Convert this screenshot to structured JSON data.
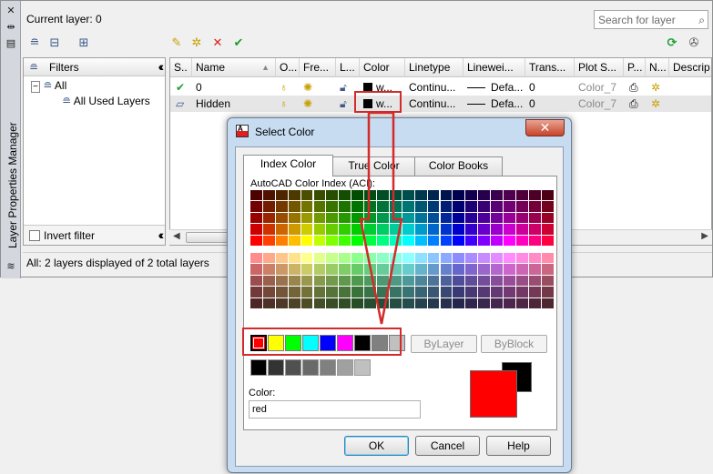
{
  "palette": {
    "title": "Layer Properties Manager",
    "current_layer": "Current layer: 0",
    "search_placeholder": "Search for layer",
    "filters": {
      "header": "Filters",
      "tree": [
        "All",
        "All Used Layers"
      ],
      "invert_label": "Invert filter"
    },
    "columns": [
      "S..",
      "Name",
      "O...",
      "Fre...",
      "L...",
      "Color",
      "Linetype",
      "Linewei...",
      "Trans...",
      "Plot S...",
      "P...",
      "N...",
      "Descrip"
    ],
    "layers": [
      {
        "name": "0",
        "color": "w...",
        "linetype": "Continu...",
        "lineweight": "Defa...",
        "transparency": "0",
        "plot_style": "Color_7"
      },
      {
        "name": "Hidden",
        "color": "w...",
        "linetype": "Continu...",
        "lineweight": "Defa...",
        "transparency": "0",
        "plot_style": "Color_7"
      }
    ],
    "status": "All: 2 layers displayed of 2 total layers"
  },
  "dialog": {
    "title": "Select Color",
    "close_glyph": "✕",
    "tabs": [
      "Index Color",
      "True Color",
      "Color Books"
    ],
    "aci_label": "AutoCAD Color Index (ACI):",
    "bylayer": "ByLayer",
    "byblock": "ByBlock",
    "color_label": "Color:",
    "color_value": "red",
    "buttons": {
      "ok": "OK",
      "cancel": "Cancel",
      "help": "Help"
    },
    "standard_colors": [
      "#ff0000",
      "#ffff00",
      "#00ff00",
      "#00ffff",
      "#0000ff",
      "#ff00ff",
      "#000000",
      "#808080",
      "#c0c0c0"
    ],
    "gray_colors": [
      "#000000",
      "#333333",
      "#505050",
      "#696969",
      "#808080",
      "#a0a0a0",
      "#c0c0c0"
    ],
    "preview_new": "#ff0000",
    "preview_old": "#000000"
  },
  "accent": "#d42a2a"
}
